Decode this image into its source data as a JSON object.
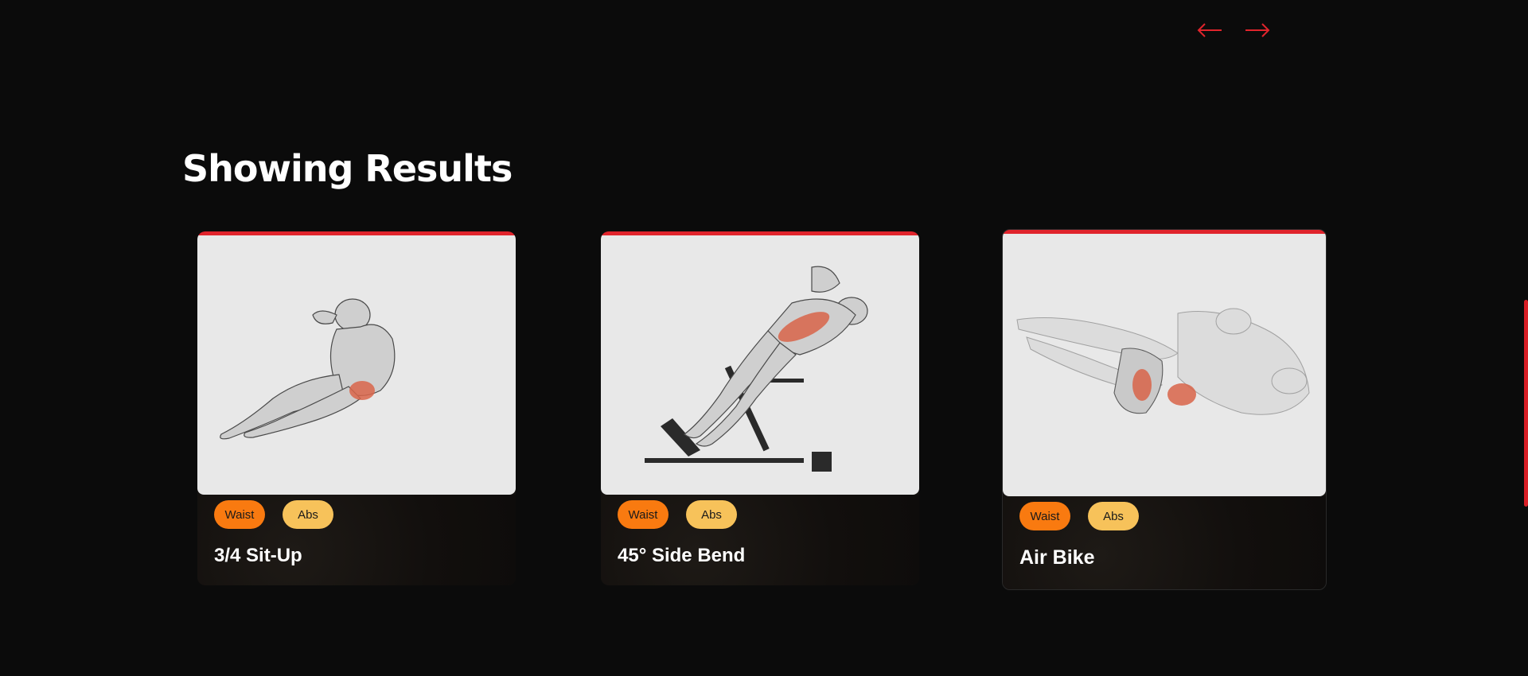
{
  "nav": {
    "prev_icon": "arrow-left-icon",
    "next_icon": "arrow-right-icon",
    "accent_color": "#e0242c"
  },
  "section": {
    "title": "Showing Results"
  },
  "cards": [
    {
      "name": "3/4 Sit-Up",
      "image_icon": "exercise-illustration",
      "tags": [
        "Waist",
        "Abs"
      ]
    },
    {
      "name": "45° Side Bend",
      "image_icon": "exercise-illustration",
      "tags": [
        "Waist",
        "Abs"
      ]
    },
    {
      "name": "Air Bike",
      "image_icon": "exercise-illustration",
      "tags": [
        "Waist",
        "Abs"
      ]
    }
  ],
  "colors": {
    "background": "#0b0b0b",
    "card_top_bar": "#e0242c",
    "tag_body_part": "#f97a10",
    "tag_target": "#f7c25a",
    "scroll_indicator": "#d81f26"
  }
}
